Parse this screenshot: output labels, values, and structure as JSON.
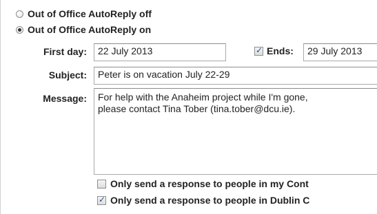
{
  "autoreply": {
    "off_label": "Out of Office AutoReply off",
    "on_label": "Out of Office AutoReply on",
    "selected": "on"
  },
  "form": {
    "first_day_label": "First day:",
    "first_day_value": "22 July 2013",
    "ends_label": "Ends:",
    "ends_checked": true,
    "ends_value": "29 July 2013",
    "subject_label": "Subject:",
    "subject_value": "Peter is on vacation July 22-29",
    "message_label": "Message:",
    "message_value": "For help with the Anaheim project while I'm gone,\nplease contact Tina Tober (tina.tober@dcu.ie)."
  },
  "options": {
    "contacts_label": "Only send a response to people in my Cont",
    "contacts_checked": false,
    "domain_label": "Only send a response to people in Dublin C",
    "domain_checked": true
  }
}
